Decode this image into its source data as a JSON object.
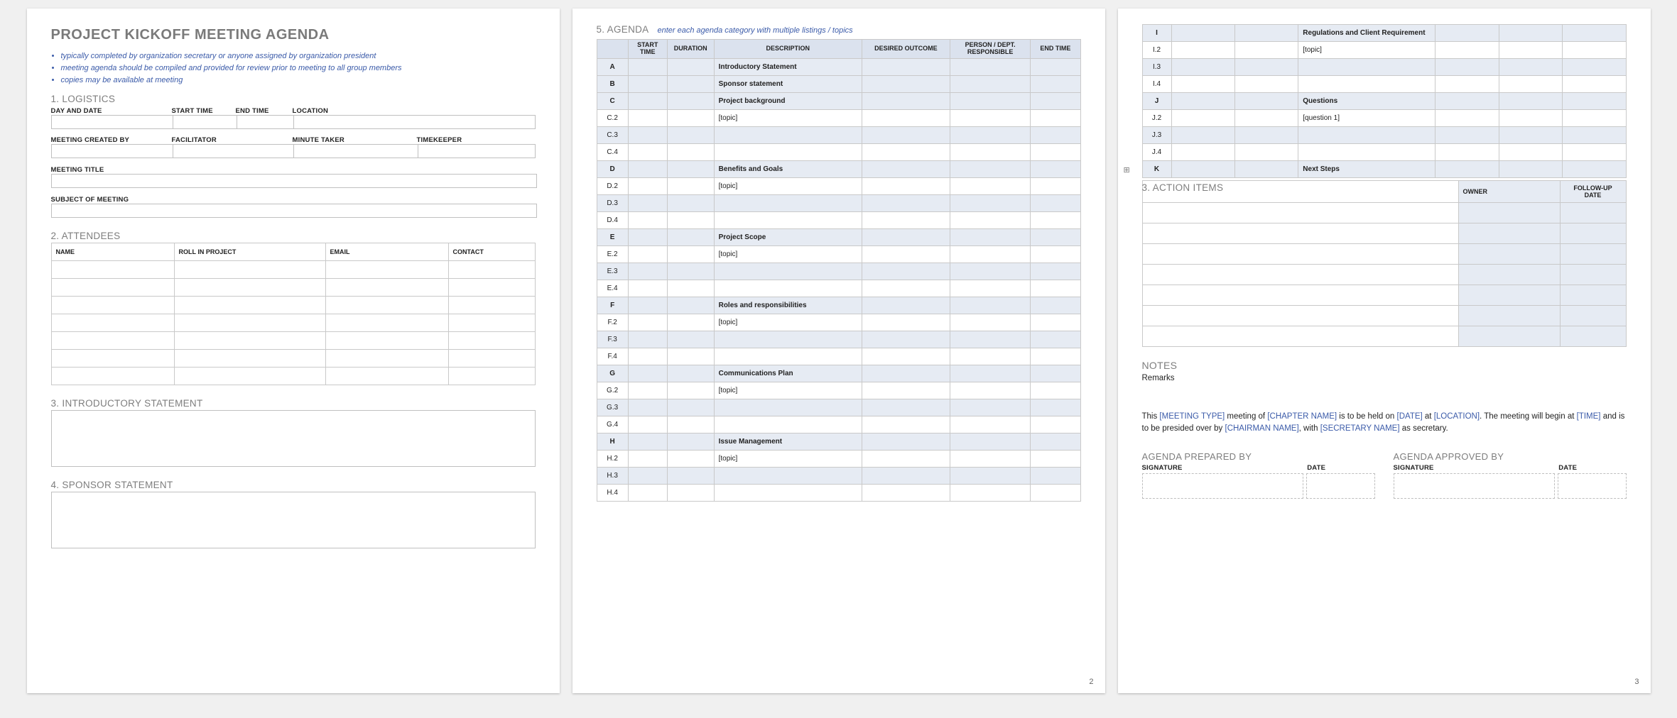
{
  "doc": {
    "title": "PROJECT KICKOFF MEETING AGENDA",
    "bullets": [
      "typically completed by organization secretary or anyone assigned by organization president",
      "meeting agenda should be compiled and provided for review prior to meeting to all group members",
      "copies may be available at meeting"
    ]
  },
  "sections": {
    "s1": "1. LOGISTICS",
    "s2": "2. ATTENDEES",
    "s3": "3. INTRODUCTORY STATEMENT",
    "s4": "4. SPONSOR STATEMENT",
    "s5": "5. AGENDA",
    "s5_sub": "enter each agenda category with multiple listings / topics",
    "s6": "3. ACTION ITEMS"
  },
  "logistics": {
    "day_date": "DAY AND DATE",
    "start_time": "START TIME",
    "end_time": "END TIME",
    "location": "LOCATION",
    "created_by": "MEETING CREATED BY",
    "facilitator": "FACILITATOR",
    "minute_taker": "MINUTE TAKER",
    "timekeeper": "TIMEKEEPER",
    "title": "MEETING TITLE",
    "subject": "SUBJECT OF MEETING"
  },
  "attendees": {
    "name": "NAME",
    "roll": "ROLL IN PROJECT",
    "email": "EMAIL",
    "contact": "CONTACT"
  },
  "agenda": {
    "cols": {
      "id": "",
      "start": "START TIME",
      "dur": "DURATION",
      "desc": "DESCRIPTION",
      "out": "DESIRED OUTCOME",
      "resp": "PERSON / DEPT. RESPONSIBLE",
      "end": "END TIME"
    },
    "topic_ph": "[topic]",
    "items_p2": [
      {
        "id": "A",
        "desc": "Introductory Statement",
        "major": true
      },
      {
        "id": "B",
        "desc": "Sponsor statement",
        "major": true
      },
      {
        "id": "C",
        "desc": "Project background",
        "major": true
      },
      {
        "id": "C.2",
        "desc": "[topic]"
      },
      {
        "id": "C.3",
        "desc": "",
        "alt": true
      },
      {
        "id": "C.4",
        "desc": ""
      },
      {
        "id": "D",
        "desc": "Benefits and Goals",
        "major": true
      },
      {
        "id": "D.2",
        "desc": "[topic]"
      },
      {
        "id": "D.3",
        "desc": "",
        "alt": true
      },
      {
        "id": "D.4",
        "desc": ""
      },
      {
        "id": "E",
        "desc": "Project Scope",
        "major": true
      },
      {
        "id": "E.2",
        "desc": "[topic]"
      },
      {
        "id": "E.3",
        "desc": "",
        "alt": true
      },
      {
        "id": "E.4",
        "desc": ""
      },
      {
        "id": "F",
        "desc": "Roles and responsibilities",
        "major": true
      },
      {
        "id": "F.2",
        "desc": "[topic]"
      },
      {
        "id": "F.3",
        "desc": "",
        "alt": true
      },
      {
        "id": "F.4",
        "desc": ""
      },
      {
        "id": "G",
        "desc": "Communications Plan",
        "major": true
      },
      {
        "id": "G.2",
        "desc": "[topic]"
      },
      {
        "id": "G.3",
        "desc": "",
        "alt": true
      },
      {
        "id": "G.4",
        "desc": ""
      },
      {
        "id": "H",
        "desc": "Issue Management",
        "major": true
      },
      {
        "id": "H.2",
        "desc": "[topic]"
      },
      {
        "id": "H.3",
        "desc": "",
        "alt": true
      },
      {
        "id": "H.4",
        "desc": ""
      }
    ],
    "items_p3": [
      {
        "id": "I",
        "desc": "Regulations and Client Requirement",
        "major": true
      },
      {
        "id": "I.2",
        "desc": "[topic]"
      },
      {
        "id": "I.3",
        "desc": "",
        "alt": true
      },
      {
        "id": "I.4",
        "desc": ""
      },
      {
        "id": "J",
        "desc": "Questions",
        "major": true
      },
      {
        "id": "J.2",
        "desc": "[question 1]"
      },
      {
        "id": "J.3",
        "desc": "",
        "alt": true
      },
      {
        "id": "J.4",
        "desc": ""
      },
      {
        "id": "K",
        "desc": "Next Steps",
        "major": true
      }
    ]
  },
  "action": {
    "owner": "OWNER",
    "follow": "FOLLOW-UP DATE"
  },
  "notes": {
    "heading": "NOTES",
    "remarks": "Remarks",
    "sentence": "This [MEETING TYPE] meeting of [CHAPTER NAME] is to be held on [DATE] at [LOCATION].  The meeting will begin at [TIME] and is to be presided over by [CHAIRMAN NAME], with [SECRETARY NAME] as secretary.",
    "prepared": "AGENDA PREPARED BY",
    "approved": "AGENDA APPROVED BY",
    "signature": "SIGNATURE",
    "date": "DATE"
  },
  "page_nums": {
    "p2": "2",
    "p3": "3"
  }
}
